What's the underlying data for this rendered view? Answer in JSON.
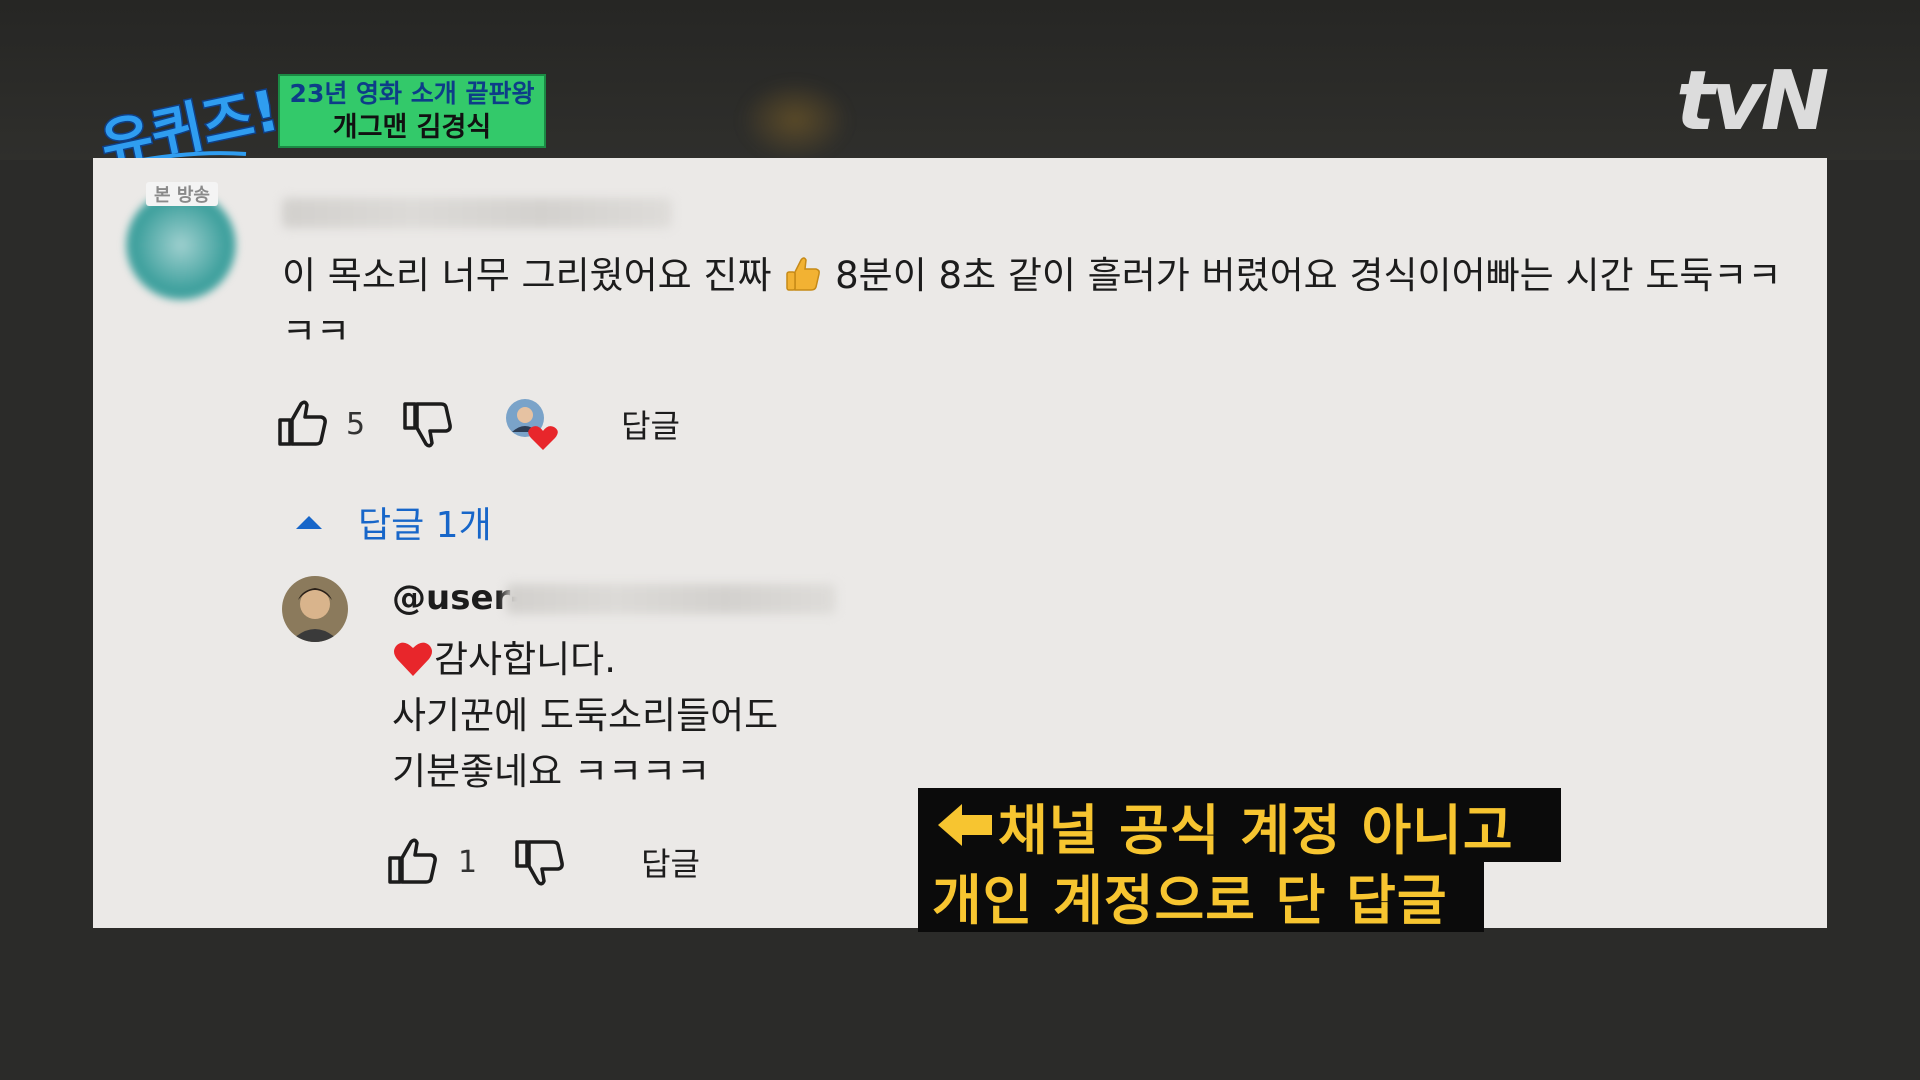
{
  "overlay": {
    "show_logo": "유퀴즈!",
    "badge_line1": "23년 영화 소개 끝판왕",
    "badge_line2": "개그맨 김경식",
    "channel_logo": "tvN",
    "caption_line1": "채널 공식 계정 아니고",
    "caption_line2": "개인 계정으로 단 답글"
  },
  "comment": {
    "broadcast_tag": "본 방송",
    "text_part1": "이 목소리 너무 그리웠어요 진짜",
    "text_part2": " 8분이 8초 같이 흘러가 버렸어요 경식이어빠는 시간 도둑ㅋㅋㅋㅋ",
    "like_count": "5",
    "reply_label": "답글",
    "replies_toggle": "답글 1개"
  },
  "reply": {
    "handle": "@user-",
    "line1": "감사합니다.",
    "line2": "사기꾼에 도둑소리들어도",
    "line3": "기분좋네요 ㅋㅋㅋㅋ",
    "like_count": "1",
    "reply_label": "답글"
  },
  "colors": {
    "panel_bg": "#ebe9e7",
    "link_blue": "#1766c9",
    "caption_yellow": "#f7c530",
    "badge_green": "#33c96a",
    "heart_red": "#e8262b"
  }
}
